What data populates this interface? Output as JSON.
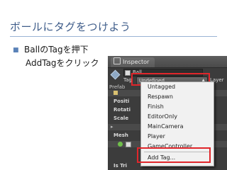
{
  "slide": {
    "title": "ボールにタグをつけよう",
    "bullet": "BallのTagを押下",
    "sub": "AddTagをクリック"
  },
  "inspector": {
    "tab_label": "Inspector",
    "object_name": "Ball",
    "tag_label": "Tag",
    "tag_value": "Undefined",
    "layer_label": "Layer",
    "prefab_label": "Prefab",
    "left_labels": [
      "Positi",
      "Rotati",
      "Scale",
      "Mesh",
      "Is Tri"
    ]
  },
  "dropdown": {
    "items": [
      "Untagged",
      "Respawn",
      "Finish",
      "EditorOnly",
      "MainCamera",
      "Player",
      "GameController"
    ],
    "add_tag": "Add Tag..."
  },
  "colors": {
    "highlight": "#e0262b",
    "title": "#3f5d8a"
  }
}
